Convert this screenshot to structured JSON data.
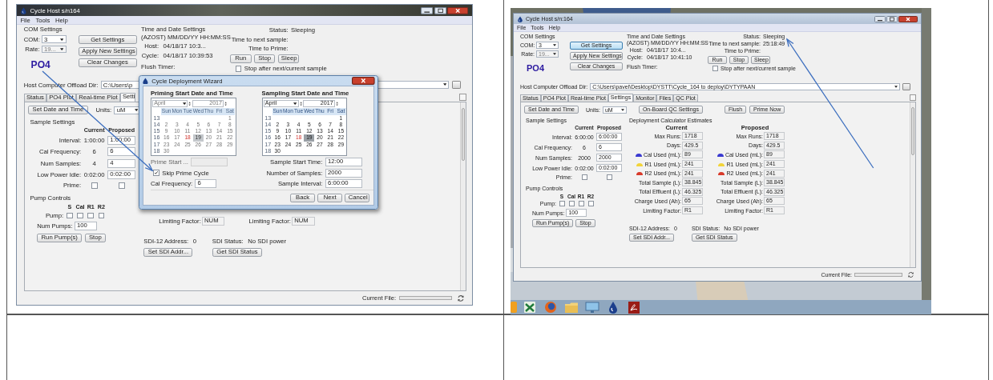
{
  "screenshots": [
    {
      "kind": "wizard",
      "window": {
        "title": "Cycle Host s/n164",
        "menu": [
          "File",
          "Tools",
          "Help"
        ],
        "com": {
          "heading": "COM Settings",
          "com_label": "COM:",
          "com_value": "3",
          "rate_label": "Rate:",
          "rate_value": "19..."
        },
        "analyte": "PO4",
        "action_buttons": [
          {
            "label": "Get Settings",
            "focused": false
          },
          {
            "label": "Apply New Settings",
            "focused": false
          },
          {
            "label": "Clear Changes",
            "focused": false
          }
        ],
        "time": {
          "heading": "Time and Date Settings",
          "format": "(AZOST) MM/DD/YY HH:MM:SS",
          "host_label": "Host:",
          "host_value": "04/18/17 10:3...",
          "cycle_label": "Cycle:",
          "cycle_value": "04/18/17 10:39:53",
          "flush_label": "Flush Timer:"
        },
        "status": {
          "status_label": "Status:",
          "status_value": "Sleeping",
          "next_label": "Time to next sample:",
          "prime_label": "Time to Prime:",
          "buttons": [
            "Run",
            "Stop",
            "Sleep"
          ],
          "stop_after": {
            "label": "Stop after next/current sample",
            "checked": false
          }
        },
        "offload": {
          "label": "Host Computer Offload Dir:",
          "value": "C:\\Users\\p"
        },
        "tabs": [
          {
            "label": "Status",
            "selected": false
          },
          {
            "label": "PO4 Plot",
            "selected": false
          },
          {
            "label": "Real-time Plot",
            "selected": false
          },
          {
            "label": "Setti",
            "selected": true
          }
        ],
        "settings": {
          "top_buttons": [
            "Set Date and Time"
          ],
          "units": {
            "label": "Units:",
            "value": "uM"
          },
          "sample": {
            "heading": "Sample Settings",
            "columns": [
              "Current",
              "Proposed"
            ],
            "rows": [
              {
                "kind": "field",
                "label": "Interval:",
                "current": "1:00:00",
                "proposed": "1:00:00"
              },
              {
                "kind": "field",
                "label": "Cal Frequency:",
                "current": "6",
                "proposed": "6"
              },
              {
                "kind": "field",
                "label": "Num Samples:",
                "current": "4",
                "proposed": "4"
              },
              {
                "kind": "field",
                "label": "Low Power Idle:",
                "current": "0:02:00",
                "proposed": "0:02:00"
              },
              {
                "kind": "checkbox",
                "label": "Prime:",
                "current_checked": false,
                "proposed_checked": false
              }
            ]
          },
          "pump": {
            "heading": "Pump Controls",
            "columns": [
              "S",
              "Cal",
              "R1",
              "R2"
            ],
            "label": "Pump:",
            "checks": [
              {
                "checked": false
              },
              {
                "checked": false
              },
              {
                "checked": false
              },
              {
                "checked": false
              }
            ],
            "num_label": "Num Pumps:",
            "num_value": "100",
            "buttons": [
              "Run Pump(s)",
              "Stop"
            ]
          },
          "calc": {
            "columns": [
              {
                "rows": [
                  {
                    "label": "Limiting Factor:",
                    "value": "NUM"
                  }
                ]
              },
              {
                "rows": [
                  {
                    "label": "Limiting Factor:",
                    "value": "NUM"
                  }
                ]
              }
            ]
          },
          "sdi": {
            "address_label": "SDI-12 Address:",
            "address_value": "0",
            "status_label": "SDI Status:",
            "status_value": "No SDI power",
            "buttons": [
              "Set SDI Addr...",
              "Get SDI Status"
            ]
          }
        },
        "status_bar": {
          "label": "Current File:",
          "level": 0
        }
      },
      "dialog": {
        "title": "Cycle Deployment Wizard",
        "calendars": [
          {
            "heading": "Priming Start Date and Time",
            "enabled": false,
            "month": "April",
            "year": "2017",
            "weekdays": [
              "Sun",
              "Mon",
              "Tue",
              "Wed",
              "Thu",
              "Fri",
              "Sat"
            ],
            "weeks": [
              {
                "number": "13",
                "days": [
                  {
                    "day": "1",
                    "today": false,
                    "selected": false
                  }
                ]
              },
              {
                "number": "14",
                "days": [
                  {
                    "day": "2",
                    "today": false,
                    "selected": false
                  },
                  {
                    "day": "3",
                    "today": false,
                    "selected": false
                  },
                  {
                    "day": "4",
                    "today": false,
                    "selected": false
                  },
                  {
                    "day": "5",
                    "today": false,
                    "selected": false
                  },
                  {
                    "day": "6",
                    "today": false,
                    "selected": false
                  },
                  {
                    "day": "7",
                    "today": false,
                    "selected": false
                  },
                  {
                    "day": "8",
                    "today": false,
                    "selected": false
                  }
                ]
              },
              {
                "number": "15",
                "days": [
                  {
                    "day": "9",
                    "today": false,
                    "selected": false
                  },
                  {
                    "day": "10",
                    "today": false,
                    "selected": false
                  },
                  {
                    "day": "11",
                    "today": false,
                    "selected": false
                  },
                  {
                    "day": "12",
                    "today": false,
                    "selected": false
                  },
                  {
                    "day": "13",
                    "today": false,
                    "selected": false
                  },
                  {
                    "day": "14",
                    "today": false,
                    "selected": false
                  },
                  {
                    "day": "15",
                    "today": false,
                    "selected": false
                  }
                ]
              },
              {
                "number": "16",
                "days": [
                  {
                    "day": "16",
                    "today": false,
                    "selected": false
                  },
                  {
                    "day": "17",
                    "today": false,
                    "selected": false
                  },
                  {
                    "day": "18",
                    "today": true,
                    "selected": false
                  },
                  {
                    "day": "19",
                    "today": false,
                    "selected": true
                  },
                  {
                    "day": "20",
                    "today": false,
                    "selected": false
                  },
                  {
                    "day": "21",
                    "today": false,
                    "selected": false
                  },
                  {
                    "day": "22",
                    "today": false,
                    "selected": false
                  }
                ]
              },
              {
                "number": "17",
                "days": [
                  {
                    "day": "23",
                    "today": false,
                    "selected": false
                  },
                  {
                    "day": "24",
                    "today": false,
                    "selected": false
                  },
                  {
                    "day": "25",
                    "today": false,
                    "selected": false
                  },
                  {
                    "day": "26",
                    "today": false,
                    "selected": false
                  },
                  {
                    "day": "27",
                    "today": false,
                    "selected": false
                  },
                  {
                    "day": "28",
                    "today": false,
                    "selected": false
                  },
                  {
                    "day": "29",
                    "today": false,
                    "selected": false
                  }
                ]
              },
              {
                "number": "18",
                "days": [
                  {
                    "day": "30",
                    "today": false,
                    "selected": false
                  }
                ]
              }
            ]
          },
          {
            "heading": "Sampling Start Date and Time",
            "enabled": true,
            "month": "April",
            "year": "2017",
            "weekdays": [
              "Sun",
              "Mon",
              "Tue",
              "Wed",
              "Thu",
              "Fri",
              "Sat"
            ],
            "weeks": [
              {
                "number": "13",
                "days": [
                  {
                    "day": "1",
                    "today": false,
                    "selected": false
                  }
                ]
              },
              {
                "number": "14",
                "days": [
                  {
                    "day": "2",
                    "today": false,
                    "selected": false
                  },
                  {
                    "day": "3",
                    "today": false,
                    "selected": false
                  },
                  {
                    "day": "4",
                    "today": false,
                    "selected": false
                  },
                  {
                    "day": "5",
                    "today": false,
                    "selected": false
                  },
                  {
                    "day": "6",
                    "today": false,
                    "selected": false
                  },
                  {
                    "day": "7",
                    "today": false,
                    "selected": false
                  },
                  {
                    "day": "8",
                    "today": false,
                    "selected": false
                  }
                ]
              },
              {
                "number": "15",
                "days": [
                  {
                    "day": "9",
                    "today": false,
                    "selected": false
                  },
                  {
                    "day": "10",
                    "today": false,
                    "selected": false
                  },
                  {
                    "day": "11",
                    "today": false,
                    "selected": false
                  },
                  {
                    "day": "12",
                    "today": false,
                    "selected": false
                  },
                  {
                    "day": "13",
                    "today": false,
                    "selected": false
                  },
                  {
                    "day": "14",
                    "today": false,
                    "selected": false
                  },
                  {
                    "day": "15",
                    "today": false,
                    "selected": false
                  }
                ]
              },
              {
                "number": "16",
                "days": [
                  {
                    "day": "16",
                    "today": false,
                    "selected": false
                  },
                  {
                    "day": "17",
                    "today": false,
                    "selected": false
                  },
                  {
                    "day": "18",
                    "today": true,
                    "selected": false
                  },
                  {
                    "day": "19",
                    "today": false,
                    "selected": true
                  },
                  {
                    "day": "20",
                    "today": false,
                    "selected": false
                  },
                  {
                    "day": "21",
                    "today": false,
                    "selected": false
                  },
                  {
                    "day": "22",
                    "today": false,
                    "selected": false
                  }
                ]
              },
              {
                "number": "17",
                "days": [
                  {
                    "day": "23",
                    "today": false,
                    "selected": false
                  },
                  {
                    "day": "24",
                    "today": false,
                    "selected": false
                  },
                  {
                    "day": "25",
                    "today": false,
                    "selected": false
                  },
                  {
                    "day": "26",
                    "today": false,
                    "selected": false
                  },
                  {
                    "day": "27",
                    "today": false,
                    "selected": false
                  },
                  {
                    "day": "28",
                    "today": false,
                    "selected": false
                  },
                  {
                    "day": "29",
                    "today": false,
                    "selected": false
                  }
                ]
              },
              {
                "number": "18",
                "days": [
                  {
                    "day": "30",
                    "today": false,
                    "selected": false
                  }
                ]
              }
            ]
          }
        ],
        "prime_start": {
          "label": "Prime Start ...",
          "enabled": false
        },
        "skip_prime": {
          "label": "Skip Prime Cycle",
          "checked": true
        },
        "cal_frequency": {
          "label": "Cal Frequency:",
          "value": "6"
        },
        "sample_start": {
          "label": "Sample Start Time:",
          "value": "12:00"
        },
        "num_samples": {
          "label": "Number of Samples:",
          "value": "2000"
        },
        "sample_interval": {
          "label": "Sample Interval:",
          "value": "6:00:00"
        },
        "buttons": [
          "Back",
          "Next",
          "Cancel"
        ]
      }
    },
    {
      "kind": "desktop",
      "window": {
        "title": "Cycle Host s/n:164",
        "menu": [
          "File",
          "Tools",
          "Help"
        ],
        "com": {
          "heading": "COM Settings",
          "com_label": "COM:",
          "com_value": "3",
          "rate_label": "Rate:",
          "rate_value": "19..."
        },
        "analyte": "PO4",
        "action_buttons": [
          {
            "label": "Get Settings",
            "focused": true
          },
          {
            "label": "Apply New Settings",
            "focused": false
          },
          {
            "label": "Clear Changes",
            "focused": false
          }
        ],
        "time": {
          "heading": "Time and Date Settings",
          "format": "(AZOST) MM/DD/YY HH:MM:SS",
          "host_label": "Host:",
          "host_value": "04/18/17 10:4...",
          "cycle_label": "Cycle:",
          "cycle_value": "04/18/17 10:41:10",
          "flush_label": "Flush Timer:"
        },
        "status": {
          "status_label": "Status:",
          "status_value": "Sleeping",
          "next_label": "Time to next sample:",
          "next_value": "25:18:49",
          "prime_label": "Time to Prime:",
          "buttons": [
            "Run",
            "Stop",
            "Sleep"
          ],
          "stop_after": {
            "label": "Stop after next/current sample",
            "checked": false
          }
        },
        "offload": {
          "label": "Host Computer Offload Dir:",
          "value": "C:\\Users\\pavel\\Desktop\\DYSTT\\Cycle_164 to deploy\\DYTYPAAN"
        },
        "tabs": [
          {
            "label": "Status",
            "selected": false
          },
          {
            "label": "PO4 Plot",
            "selected": false
          },
          {
            "label": "Real-time Plot",
            "selected": false
          },
          {
            "label": "Settings",
            "selected": true
          },
          {
            "label": "Monitor",
            "selected": false
          },
          {
            "label": "Files",
            "selected": false
          },
          {
            "label": "QC Plot",
            "selected": false
          }
        ],
        "settings": {
          "top_buttons": [
            "Set Date and Time"
          ],
          "units": {
            "label": "Units:",
            "value": "uM"
          },
          "qc_buttons": [
            "On-Board QC Settings"
          ],
          "flush_buttons": [
            "Flush",
            "Prime Now"
          ],
          "sample": {
            "heading": "Sample Settings",
            "columns": [
              "Current",
              "Proposed"
            ],
            "rows": [
              {
                "kind": "field",
                "label": "Interval:",
                "current": "6:00:00",
                "proposed": "6:00:00"
              },
              {
                "kind": "field",
                "label": "Cal Frequency:",
                "current": "6",
                "proposed": "6"
              },
              {
                "kind": "field",
                "label": "Num Samples:",
                "current": "2000",
                "proposed": "2000"
              },
              {
                "kind": "field",
                "label": "Low Power Idle:",
                "current": "0:02:00",
                "proposed": "0:02:00"
              },
              {
                "kind": "checkbox",
                "label": "Prime:",
                "current_checked": false,
                "proposed_checked": false
              }
            ]
          },
          "pump": {
            "heading": "Pump Controls",
            "columns": [
              "S",
              "Cal",
              "R1",
              "R2"
            ],
            "label": "Pump:",
            "checks": [
              {
                "checked": false
              },
              {
                "checked": false
              },
              {
                "checked": false
              },
              {
                "checked": false
              }
            ],
            "num_label": "Num Pumps:",
            "num_value": "100",
            "buttons": [
              "Run Pump(s)",
              "Stop"
            ]
          },
          "calc": {
            "heading": "Deployment Calculator Estimates",
            "columns": [
              {
                "title": "Current",
                "rows": [
                  {
                    "label": "Max Runs:",
                    "value": "1718"
                  },
                  {
                    "label": "Days:",
                    "value": "429.5"
                  },
                  {
                    "label": "Cal Used (mL):",
                    "value": "89",
                    "color": "#3a3ad0"
                  },
                  {
                    "label": "R1 Used (mL):",
                    "value": "241",
                    "color": "#f2d43a"
                  },
                  {
                    "label": "R2 Used (mL):",
                    "value": "241",
                    "color": "#d83a2a"
                  },
                  {
                    "label": "Total Sample (L):",
                    "value": "38.845"
                  },
                  {
                    "label": "Total Effluent (L):",
                    "value": "46.325"
                  },
                  {
                    "label": "Charge Used (Ah):",
                    "value": "65"
                  },
                  {
                    "label": "Limiting Factor:",
                    "value": "R1"
                  }
                ]
              },
              {
                "title": "Proposed",
                "rows": [
                  {
                    "label": "Max Runs:",
                    "value": "1718"
                  },
                  {
                    "label": "Days:",
                    "value": "429.5"
                  },
                  {
                    "label": "Cal Used (mL):",
                    "value": "89",
                    "color": "#3a3ad0"
                  },
                  {
                    "label": "R1 Used (mL):",
                    "value": "241",
                    "color": "#f2d43a"
                  },
                  {
                    "label": "R2 Used (mL):",
                    "value": "241",
                    "color": "#d83a2a"
                  },
                  {
                    "label": "Total Sample (L):",
                    "value": "38.845"
                  },
                  {
                    "label": "Total Effluent (L):",
                    "value": "46.325"
                  },
                  {
                    "label": "Charge Used (Ah):",
                    "value": "65"
                  },
                  {
                    "label": "Limiting Factor:",
                    "value": "R1"
                  }
                ]
              }
            ]
          },
          "sdi": {
            "address_label": "SDI-12 Address:",
            "address_value": "0",
            "status_label": "SDI Status:",
            "status_value": "No SDI power",
            "buttons": [
              "Set SDI Addr...",
              "Get SDI Status"
            ]
          }
        },
        "status_bar": {
          "label": "Current File:",
          "level": 0
        }
      }
    }
  ]
}
